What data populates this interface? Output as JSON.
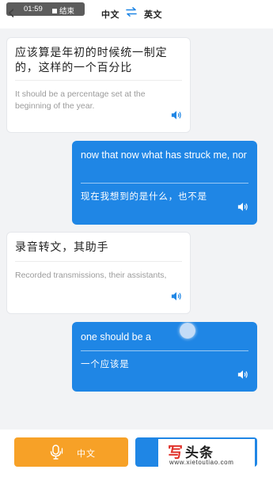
{
  "colors": {
    "accent_blue": "#1f86e5",
    "accent_orange": "#f7a127",
    "background": "#f2f3f5",
    "watermark_red": "#e0322b"
  },
  "status": {
    "timer": "01:59",
    "stop_label": "结束",
    "back_icon": "chevron-left-icon"
  },
  "header": {
    "source_lang": "中文",
    "target_lang": "英文",
    "swap_icon": "swap-arrows-icon"
  },
  "messages": [
    {
      "side": "left",
      "primary": "应该算是年初的时候统一制定的，这样的一个百分比",
      "secondary": "It should be a percentage set at the beginning of the year."
    },
    {
      "side": "right",
      "primary": "now that now what has struck me, nor",
      "secondary": "现在我想到的是什么，也不是"
    },
    {
      "side": "left",
      "primary": "录音转文，其助手",
      "secondary": "Recorded transmissions, their assistants,"
    },
    {
      "side": "right",
      "primary": "one should be a",
      "secondary": "一个应该是"
    }
  ],
  "bottom": {
    "chinese_button_label": "中文",
    "mic_icon": "microphone-icon"
  },
  "watermark": {
    "mark": "写",
    "name": "头条",
    "url": "www.xietoutiao.com"
  }
}
